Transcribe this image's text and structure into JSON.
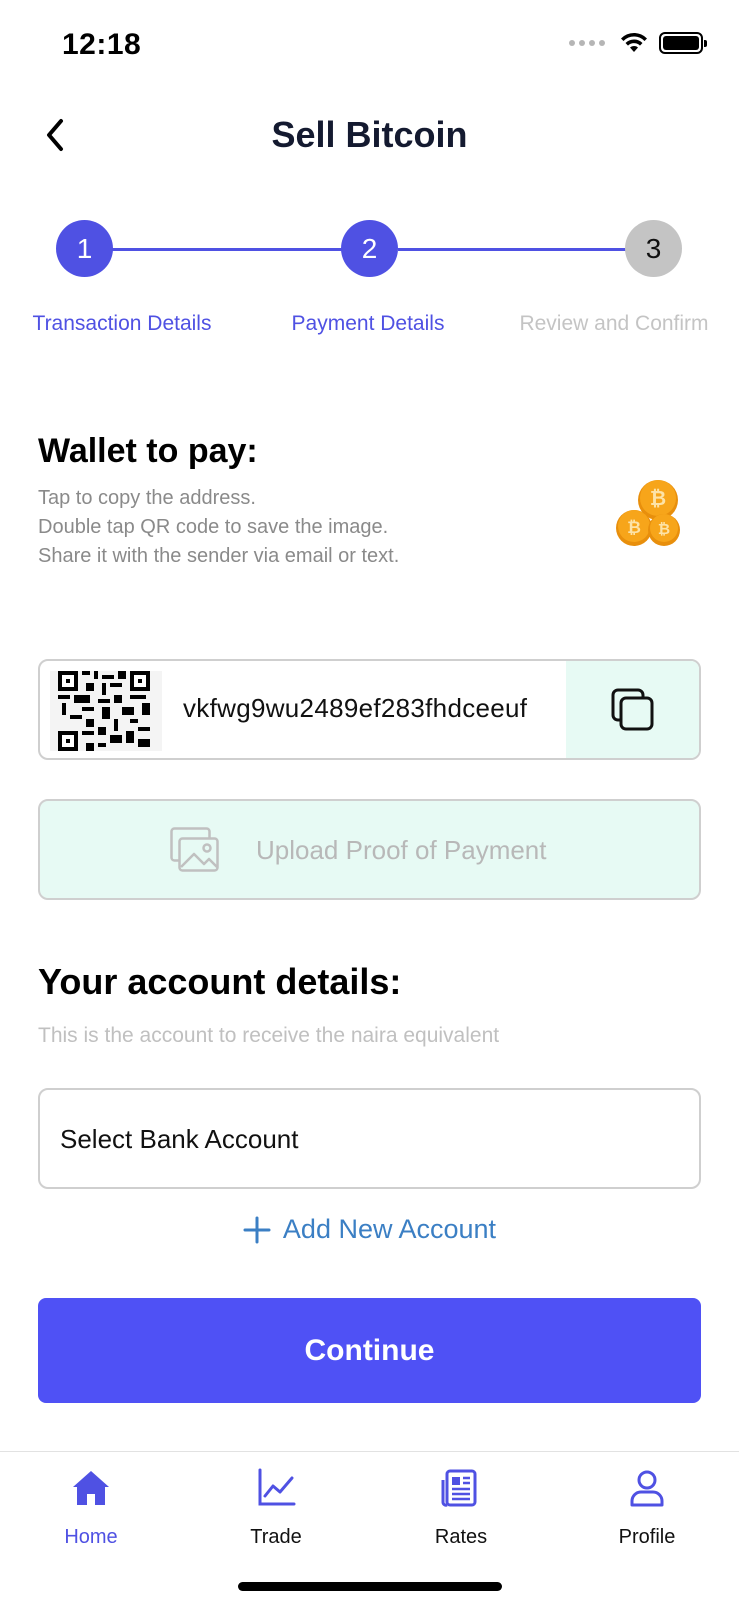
{
  "status_bar": {
    "time": "12:18"
  },
  "header": {
    "title": "Sell Bitcoin"
  },
  "stepper": {
    "steps": [
      {
        "number": "1",
        "label": "Transaction Details",
        "state": "active"
      },
      {
        "number": "2",
        "label": "Payment Details",
        "state": "active"
      },
      {
        "number": "3",
        "label": "Review and Confirm",
        "state": "inactive"
      }
    ]
  },
  "wallet": {
    "title": "Wallet to pay:",
    "instructions": [
      "Tap to copy the address.",
      "Double tap QR code to save the image.",
      "Share it with the sender via email or text."
    ],
    "address": "vkfwg9wu2489ef283fhdceeuf"
  },
  "upload": {
    "label": "Upload Proof of Payment"
  },
  "account": {
    "title": "Your account details:",
    "description": "This is the account to receive the naira equivalent",
    "select_label": "Select Bank Account",
    "add_label": "Add New Account"
  },
  "actions": {
    "continue_label": "Continue"
  },
  "tab_bar": {
    "tabs": [
      {
        "label": "Home",
        "icon": "home-icon",
        "active": true
      },
      {
        "label": "Trade",
        "icon": "chart-icon",
        "active": false
      },
      {
        "label": "Rates",
        "icon": "news-icon",
        "active": false
      },
      {
        "label": "Profile",
        "icon": "user-icon",
        "active": false
      }
    ]
  },
  "colors": {
    "accent": "#4f51e3",
    "button": "#4f51f5",
    "mint": "#e7faf4",
    "link": "#3b7fc4",
    "bitcoin": "#f7a51a"
  }
}
